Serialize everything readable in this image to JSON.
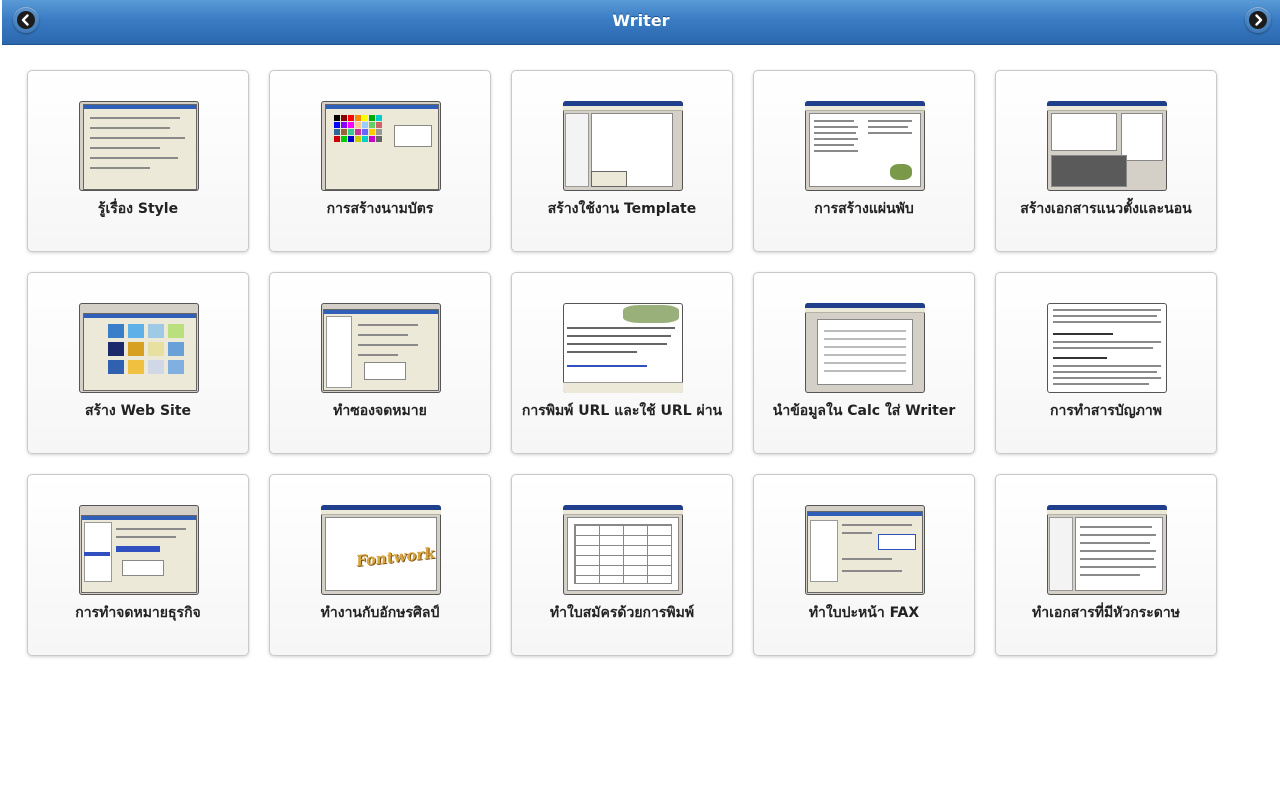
{
  "header": {
    "title": "Writer",
    "back_icon": "chevron-left-icon",
    "forward_icon": "chevron-right-icon",
    "accent_color": "#3a7cc4"
  },
  "items": [
    {
      "label": "รู้เรื่อง Style"
    },
    {
      "label": "การสร้างนามบัตร"
    },
    {
      "label": "สร้างใช้งาน Template"
    },
    {
      "label": "การสร้างแผ่นพับ"
    },
    {
      "label": "สร้างเอกสารแนวตั้งและนอน"
    },
    {
      "label": "สร้าง Web Site"
    },
    {
      "label": "ทำซองจดหมาย"
    },
    {
      "label": "การพิมพ์ URL และใช้ URL ผ่าน"
    },
    {
      "label": "นำข้อมูลใน Calc ใส่ Writer"
    },
    {
      "label": "การทำสารบัญภาพ"
    },
    {
      "label": "การทำจดหมายธุรกิจ"
    },
    {
      "label": "ทำงานกับอักษรศิลป์"
    },
    {
      "label": "ทำใบสมัครด้วยการพิมพ์"
    },
    {
      "label": "ทำใบปะหน้า FAX"
    },
    {
      "label": "ทำเอกสารที่มีหัวกระดาษ",
      "thumb_text": "Fontwork"
    }
  ],
  "fontwork_text": "Fontwork"
}
